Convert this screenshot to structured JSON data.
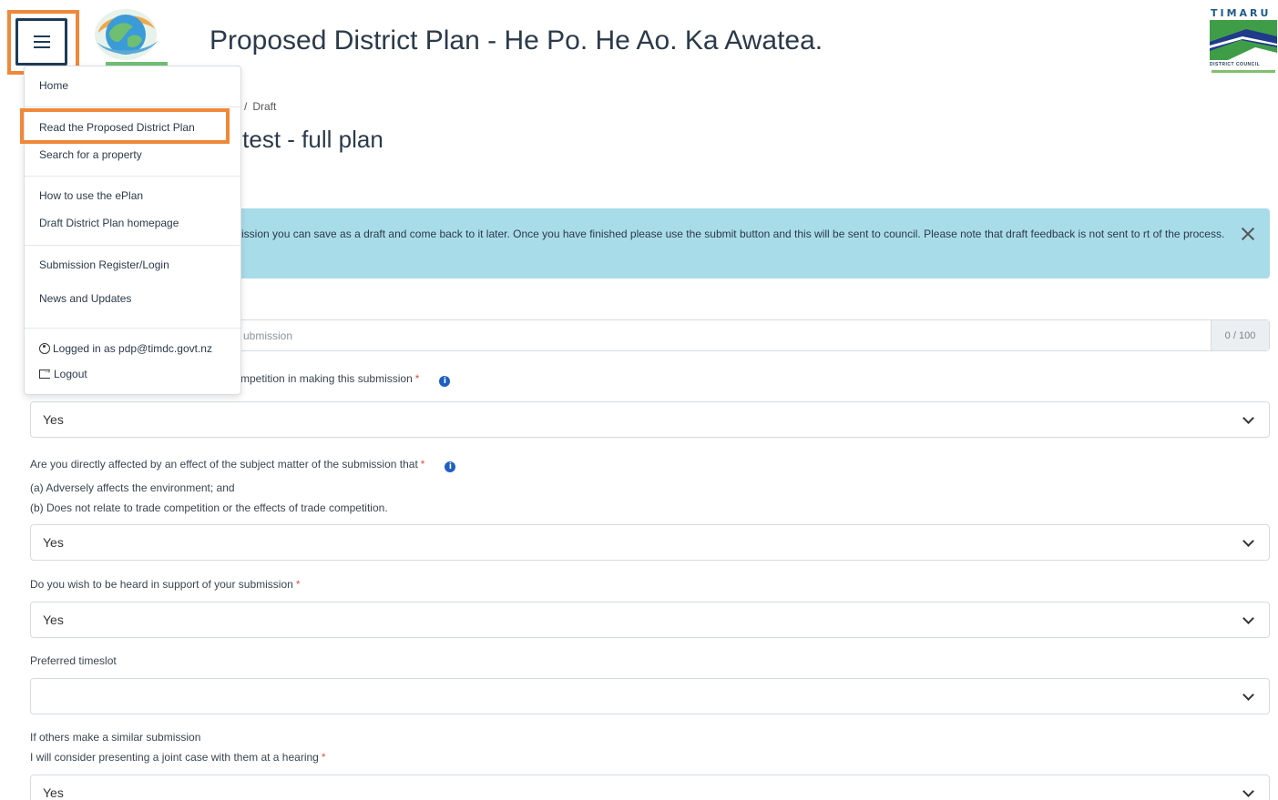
{
  "header": {
    "site_title": "Proposed District Plan - He Po. He Ao. Ka Awatea.",
    "council_name": "TIMARU",
    "council_subtitle": "DISTRICT COUNCIL"
  },
  "breadcrumb": {
    "separator": "/",
    "current": "Draft"
  },
  "page_title": "03 test - full plan",
  "alert": {
    "text": "ission you can save as a draft and come back to it later. Once you have finished please use the submit button and this will be sent to council. Please note that draft feedback is not sent to rt of the process."
  },
  "title_field": {
    "placeholder": "ubmission",
    "counter": "0 / 100"
  },
  "questions": {
    "q1": {
      "label": "mpetition in making this submission",
      "value": "Yes"
    },
    "q2": {
      "label": "Are you directly affected by an effect of the subject matter of the submission that",
      "line_a": "(a) Adversely affects the environment; and",
      "line_b": "(b) Does not relate to trade competition or the effects of trade competition.",
      "value": "Yes"
    },
    "q3": {
      "label": "Do you wish to be heard in support of your submission",
      "value": "Yes"
    },
    "q4": {
      "label": "Preferred timeslot",
      "value": ""
    },
    "q5": {
      "line1": "If others make a similar submission",
      "label": "I will consider presenting a joint case with them at a hearing",
      "value": "Yes"
    }
  },
  "required_mark": "*",
  "info_icon_glyph": "i",
  "nav_menu": {
    "home": "Home",
    "read_plan": "Read the Proposed District Plan",
    "search_property": "Search for a property",
    "how_to_use": "How to use the ePlan",
    "draft_homepage": "Draft District Plan homepage",
    "submission_login": "Submission Register/Login",
    "news": "News and Updates",
    "logged_in": "Logged in as pdp@timdc.govt.nz",
    "logout": "Logout"
  },
  "colors": {
    "highlight": "#f0883a",
    "alert_bg": "#a9dce9",
    "title_text": "#2b3a4a",
    "info_icon": "#1f5fc2",
    "required": "#d9534f"
  }
}
